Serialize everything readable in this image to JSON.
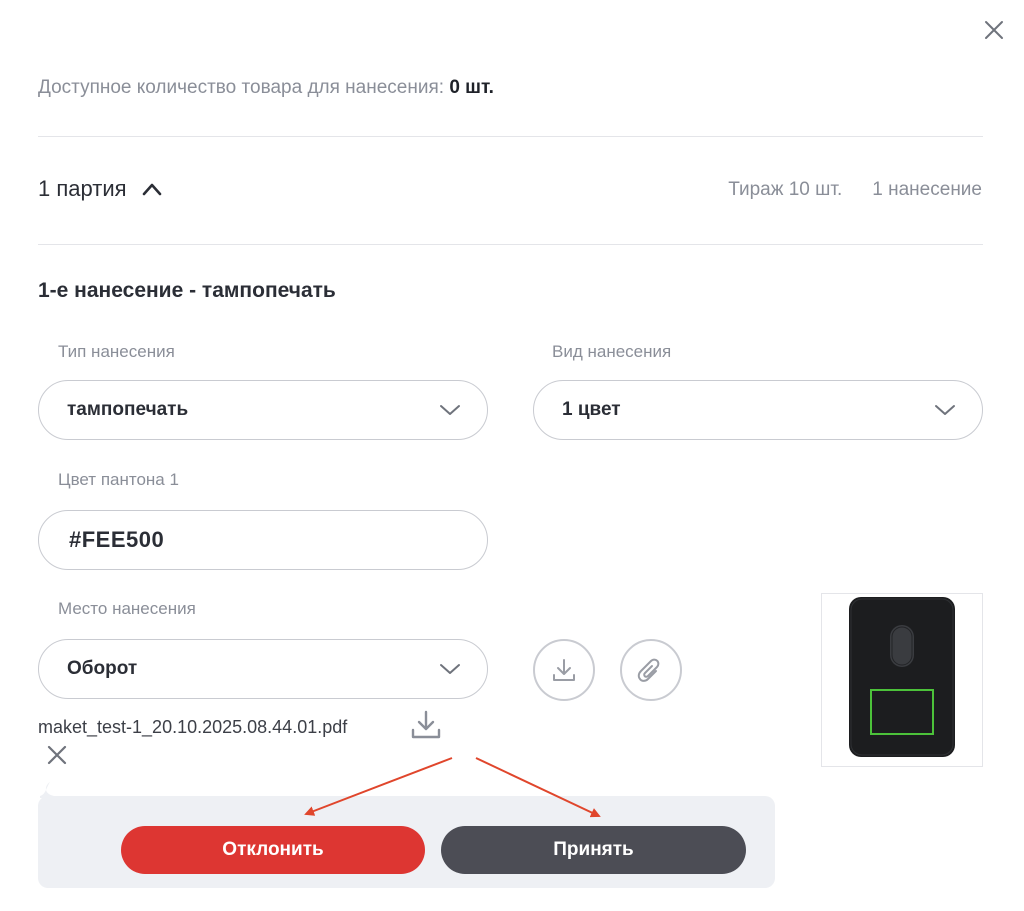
{
  "available": {
    "label": "Доступное количество товара для нанесения:",
    "value": "0 шт."
  },
  "batch": {
    "title": "1 партия",
    "print_run": "Тираж 10 шт.",
    "applications": "1 нанесение"
  },
  "application": {
    "title": "1-е нанесение - тампопечать",
    "type": {
      "label": "Тип нанесения",
      "value": "тампопечать"
    },
    "kind": {
      "label": "Вид нанесения",
      "value": "1 цвет"
    },
    "pantone": {
      "label": "Цвет пантона 1",
      "value": "#FEE500"
    },
    "place": {
      "label": "Место нанесения",
      "value": "Оборот"
    },
    "file": {
      "name": "maket_test-1_20.10.2025.08.44.01.pdf"
    }
  },
  "actions": {
    "reject_label": "Отклонить",
    "accept_label": "Принять"
  },
  "colors": {
    "reject": "#dd3632",
    "accept": "#4c4d55",
    "print_area": "#4cc23a",
    "annotation_arrow": "#e0462c",
    "muted_text": "#8a8e98"
  },
  "icons": [
    "close-icon",
    "chevron-up-icon",
    "chevron-down-icon",
    "download-icon",
    "paperclip-icon",
    "remove-icon"
  ]
}
